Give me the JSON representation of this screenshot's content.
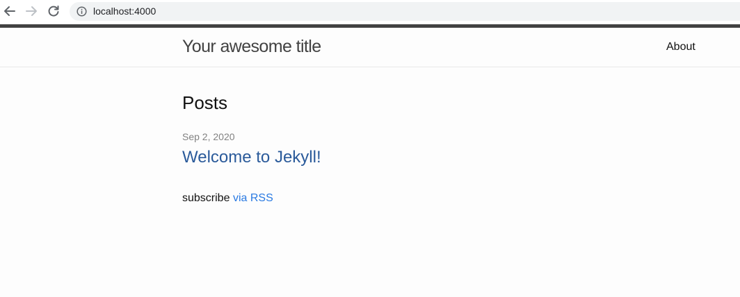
{
  "browser": {
    "url": "localhost:4000",
    "icons": {
      "back": "arrow-left-icon",
      "forward": "arrow-right-icon",
      "reload": "reload-icon",
      "site_info": "info-icon"
    }
  },
  "header": {
    "site_title": "Your awesome title",
    "nav": [
      {
        "label": "About"
      }
    ]
  },
  "main": {
    "heading": "Posts",
    "posts": [
      {
        "date": "Sep 2, 2020",
        "title": "Welcome to Jekyll!"
      }
    ],
    "subscribe_text": "subscribe",
    "rss_link": "via RSS"
  },
  "colors": {
    "accent_link": "#2a7ae2",
    "post_title": "#2a5a9a",
    "header_top_border": "#424242"
  }
}
